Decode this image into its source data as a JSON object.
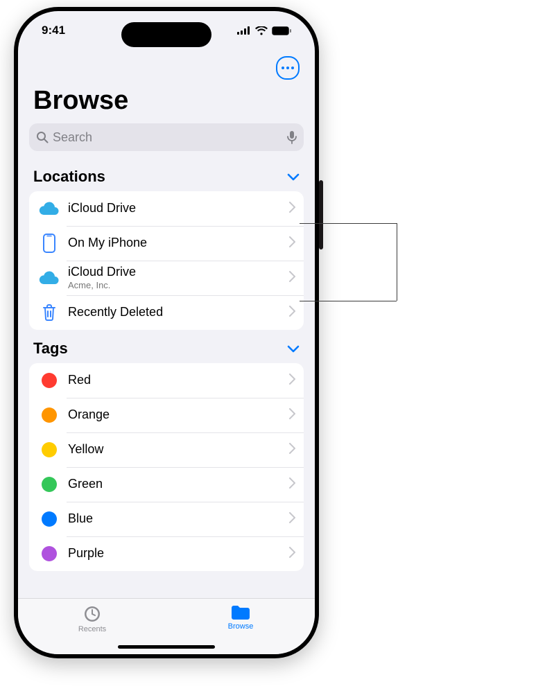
{
  "status": {
    "time": "9:41"
  },
  "header": {
    "title": "Browse"
  },
  "search": {
    "placeholder": "Search"
  },
  "sections": {
    "locations": {
      "title": "Locations",
      "items": [
        {
          "label": "iCloud Drive",
          "sublabel": ""
        },
        {
          "label": "On My iPhone",
          "sublabel": ""
        },
        {
          "label": "iCloud Drive",
          "sublabel": "Acme, Inc."
        },
        {
          "label": "Recently Deleted",
          "sublabel": ""
        }
      ]
    },
    "tags": {
      "title": "Tags",
      "items": [
        {
          "label": "Red",
          "color": "#ff3b30"
        },
        {
          "label": "Orange",
          "color": "#ff9500"
        },
        {
          "label": "Yellow",
          "color": "#ffcc00"
        },
        {
          "label": "Green",
          "color": "#34c759"
        },
        {
          "label": "Blue",
          "color": "#007aff"
        },
        {
          "label": "Purple",
          "color": "#af52de"
        }
      ]
    }
  },
  "tabs": {
    "recents": "Recents",
    "browse": "Browse"
  }
}
